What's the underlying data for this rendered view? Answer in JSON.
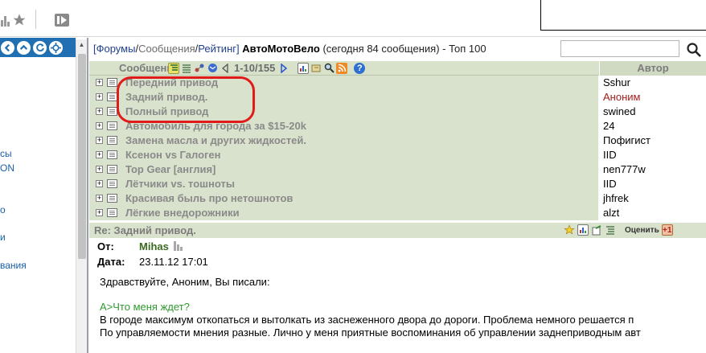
{
  "breadcrumb": {
    "forums": "[Форумы",
    "sep1": "/",
    "messages": "Сообщения",
    "sep2": "/",
    "rating": "Рейтинг]",
    "section": "АвтоМотоВело",
    "today": "(сегодня 84 сообщения) - Топ 100"
  },
  "search": {
    "placeholder": ""
  },
  "sidebar": {
    "links": [
      "сы",
      "ON",
      "о",
      "и",
      "вания"
    ]
  },
  "list": {
    "subject_header": "Сообщения",
    "author_header": "Автор",
    "pager": "1-10/155",
    "rows": [
      {
        "subject": "Передний привод",
        "author": "Sshur",
        "author_color": "#000000"
      },
      {
        "subject": "Задний привод.",
        "author": "Аноним",
        "author_color": "#a3201d"
      },
      {
        "subject": "Полный привод",
        "author": "swined",
        "author_color": "#000000"
      },
      {
        "subject": "Автомобиль для города за $15-20k",
        "author": "24",
        "author_color": "#000000"
      },
      {
        "subject": "Замена масла и других жидкостей.",
        "author": "Пофигист",
        "author_color": "#000000"
      },
      {
        "subject": "Ксенон vs Галоген",
        "author": "IID",
        "author_color": "#000000"
      },
      {
        "subject": "Top Gear [англия]",
        "author": "nen777w",
        "author_color": "#000000"
      },
      {
        "subject": "Лётчики vs. тошноты",
        "author": "IID",
        "author_color": "#000000"
      },
      {
        "subject": "Красивая быль про нетошнотов",
        "author": "jhfrek",
        "author_color": "#000000"
      },
      {
        "subject": "Лёгкие внедорожники",
        "author": "alzt",
        "author_color": "#000000"
      }
    ]
  },
  "message": {
    "title": "Re: Задний привод.",
    "rate_label": "Оценить",
    "from_label": "От:",
    "from_value": "Mihas",
    "date_label": "Дата:",
    "date_value": "23.11.12 17:01",
    "greeting": "Здравствуйте, Аноним, Вы писали:",
    "quote": "А>Что меня ждет?",
    "line1": "В городе максимум откопаться и вытолкать из заснеженного двора до дороги. Проблема немного решается п",
    "line2": "По управляемости мнения разные. Лично у меня приятные воспоминания об управлении заднеприводным авт"
  },
  "colors": {
    "accent_blue": "#1f6fb2",
    "header_green": "#d9e2cc",
    "highlight_red": "#e11a1a"
  }
}
